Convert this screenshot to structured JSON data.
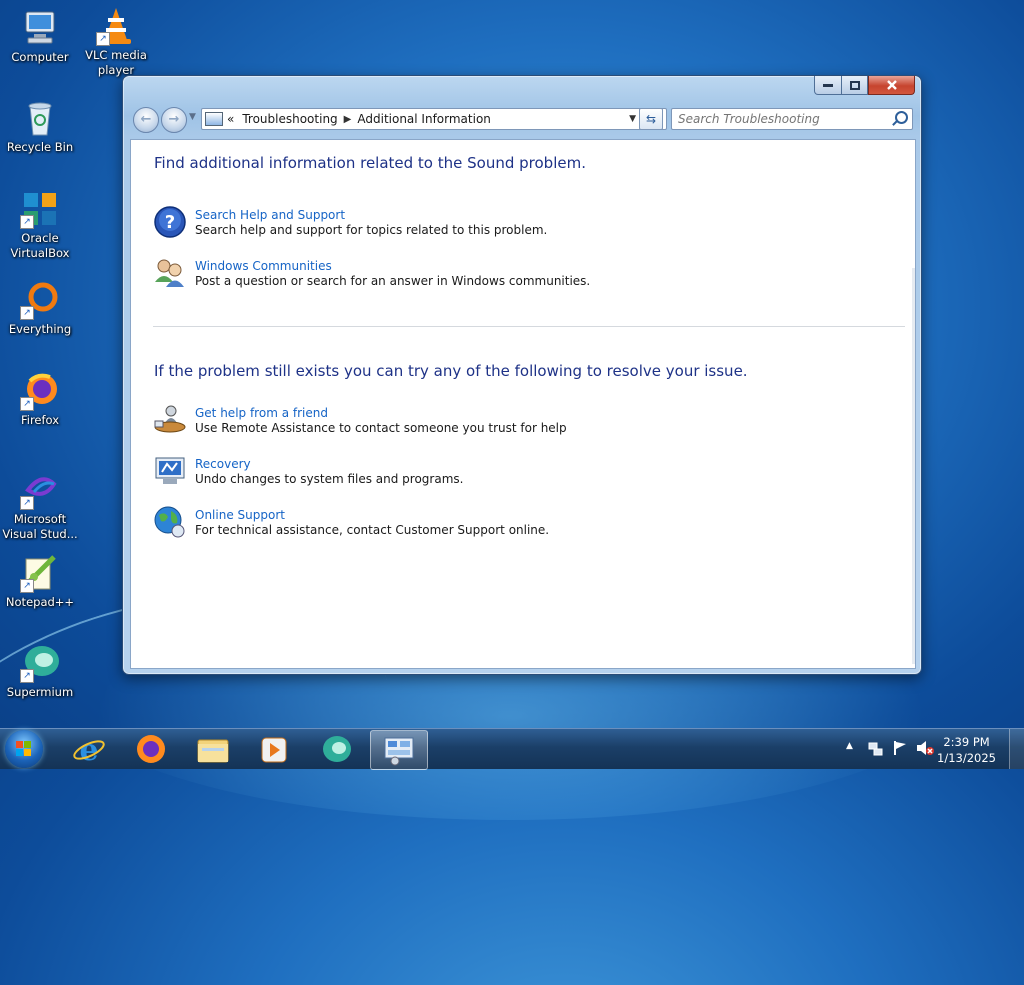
{
  "desktop": {
    "icons": [
      {
        "label": "Computer"
      },
      {
        "label": "VLC media player"
      },
      {
        "label": "Recycle Bin"
      },
      {
        "label": "Oracle VirtualBox"
      },
      {
        "label": "Everything"
      },
      {
        "label": "Firefox"
      },
      {
        "label": "Microsoft Visual Stud..."
      },
      {
        "label": "Notepad++"
      },
      {
        "label": "Supermium"
      }
    ]
  },
  "window": {
    "breadcrumb": {
      "prefix": "«",
      "items": [
        "Troubleshooting",
        "Additional Information"
      ]
    },
    "search": {
      "placeholder": "Search Troubleshooting"
    },
    "heading1": "Find additional information related to the Sound problem.",
    "section1": [
      {
        "title": "Search Help and Support",
        "desc": "Search help and support for topics related to this problem."
      },
      {
        "title": "Windows Communities",
        "desc": "Post a question or search for an answer in Windows communities."
      }
    ],
    "heading2": "If the problem still exists you can try any of the following to resolve your issue.",
    "section2": [
      {
        "title": "Get help from a friend",
        "desc": "Use Remote Assistance to contact someone you trust for help"
      },
      {
        "title": "Recovery",
        "desc": "Undo changes to system files and programs."
      },
      {
        "title": "Online Support",
        "desc": "For technical assistance, contact Customer Support online."
      }
    ]
  },
  "taskbar": {
    "clock": {
      "time": "2:39 PM",
      "date": "1/13/2025"
    }
  }
}
